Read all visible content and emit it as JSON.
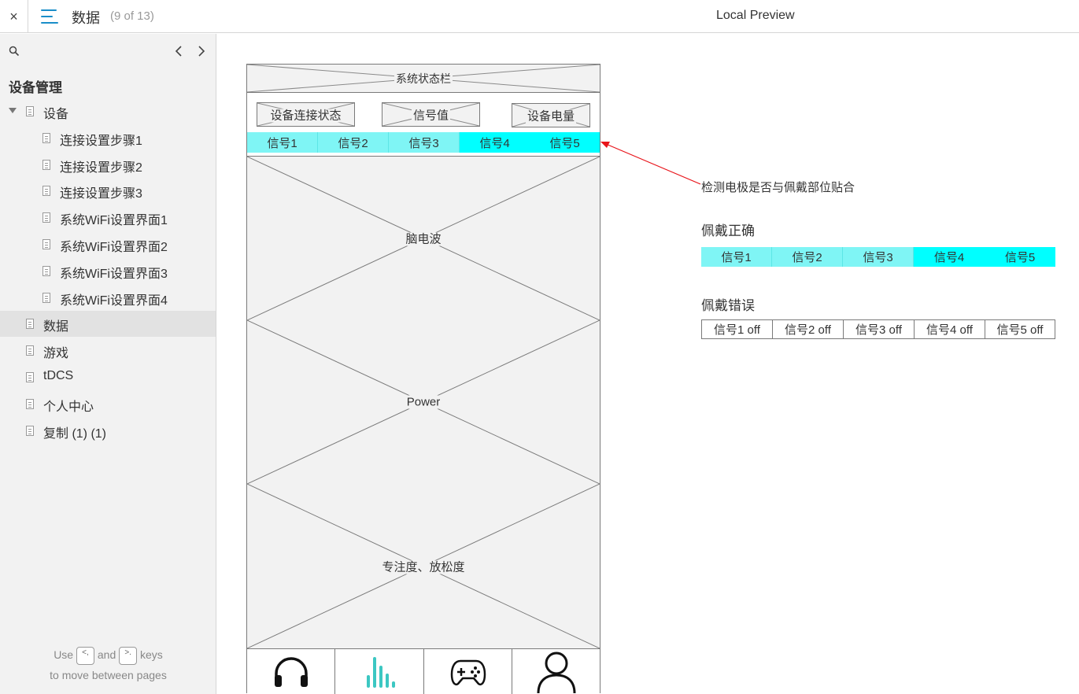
{
  "topbar": {
    "close": "×",
    "page_title": "数据",
    "page_count": "(9 of 13)",
    "preview_title": "Local Preview"
  },
  "sidebar": {
    "root": "设备管理",
    "items": [
      {
        "label": "设备",
        "level": 1,
        "expanded": true
      },
      {
        "label": "连接设置步骤1",
        "level": 2
      },
      {
        "label": "连接设置步骤2",
        "level": 2
      },
      {
        "label": "连接设置步骤3",
        "level": 2
      },
      {
        "label": "系统WiFi设置界面1",
        "level": 2
      },
      {
        "label": "系统WiFi设置界面2",
        "level": 2
      },
      {
        "label": "系统WiFi设置界面3",
        "level": 2
      },
      {
        "label": "系统WiFi设置界面4",
        "level": 2
      },
      {
        "label": "数据",
        "level": 1,
        "selected": true
      },
      {
        "label": "游戏",
        "level": 1
      },
      {
        "label": "tDCS",
        "level": 1
      },
      {
        "label": "个人中心",
        "level": 1
      },
      {
        "label": "复制 (1) (1)",
        "level": 1
      }
    ],
    "hint": {
      "use": "Use",
      "and": "and",
      "keys": "keys",
      "line2": "to move between pages",
      "key_prev": "<,",
      "key_next": ">."
    }
  },
  "mockup": {
    "status_bar": "系统状态栏",
    "buttons": [
      "设备连接状态",
      "信号值",
      "设备电量"
    ],
    "signals": [
      "信号1",
      "信号2",
      "信号3",
      "信号4",
      "信号5"
    ],
    "panels": [
      "脑电波",
      "Power",
      "专注度、放松度"
    ],
    "tabs": [
      {
        "icon": "headphones-icon"
      },
      {
        "icon": "bar-chart-icon"
      },
      {
        "icon": "gamepad-icon"
      },
      {
        "icon": "user-icon"
      }
    ]
  },
  "notes": {
    "annotation": "检测电极是否与佩戴部位贴合",
    "correct_title": "佩戴正确",
    "correct_signals": [
      "信号1",
      "信号2",
      "信号3",
      "信号4",
      "信号5"
    ],
    "wrong_title": "佩戴错误",
    "wrong_signals": [
      "信号1 off",
      "信号2 off",
      "信号3 off",
      "信号4 off",
      "信号5 off"
    ]
  },
  "colors": {
    "accent": "#1a8ec9",
    "signal_on": "#00ffff",
    "signal_light": "#7ff5f5",
    "arrow": "#e8141a",
    "tab_active": "#3cc7c2"
  }
}
